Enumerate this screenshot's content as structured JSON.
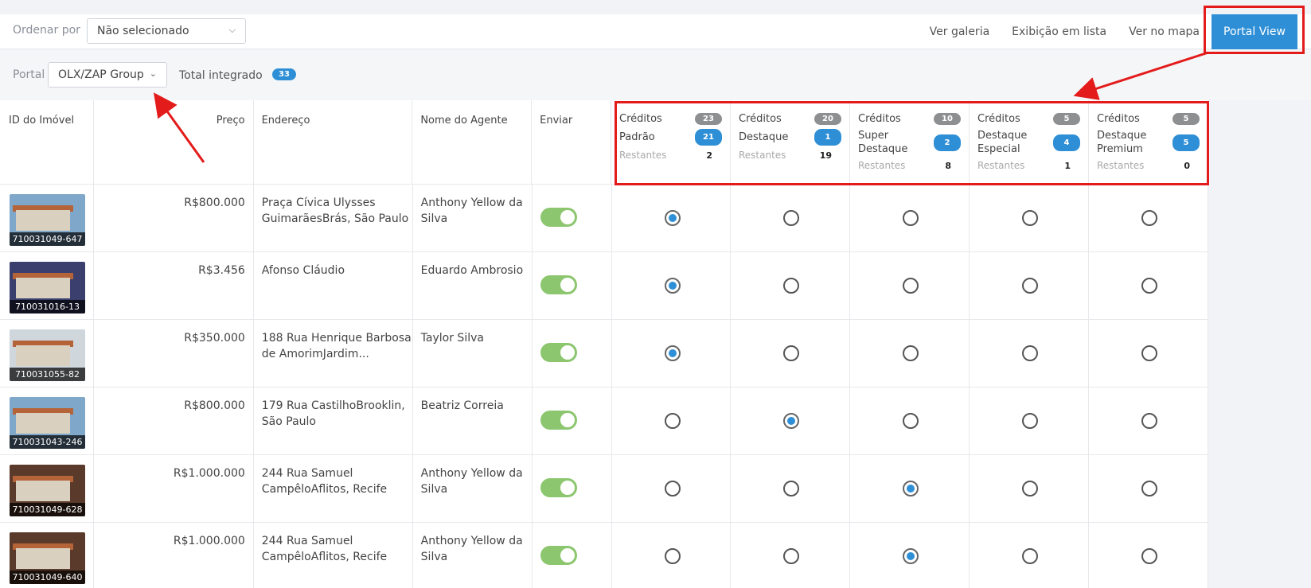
{
  "toolbar": {
    "sort_label": "Ordenar por",
    "sort_value": "Não selecionado",
    "views": [
      "Ver galeria",
      "Exibição em lista",
      "Ver no mapa"
    ],
    "portal_view_label": "Portal View"
  },
  "filters": {
    "portal_label": "Portal",
    "portal_value": "OLX/ZAP Group",
    "total_label": "Total integrado",
    "total_count": "33"
  },
  "columns": {
    "id": "ID do Imóvel",
    "price": "Preço",
    "address": "Endereço",
    "agent": "Nome do Agente",
    "send": "Enviar"
  },
  "credits": [
    {
      "credits_label": "Créditos",
      "credits": "23",
      "type_label": "Padrão",
      "type_count": "21",
      "remaining_label": "Restantes",
      "remaining": "2"
    },
    {
      "credits_label": "Créditos",
      "credits": "20",
      "type_label": "Destaque",
      "type_count": "1",
      "remaining_label": "Restantes",
      "remaining": "19"
    },
    {
      "credits_label": "Créditos",
      "credits": "10",
      "type_label": "Super Destaque",
      "type_count": "2",
      "remaining_label": "Restantes",
      "remaining": "8"
    },
    {
      "credits_label": "Créditos",
      "credits": "5",
      "type_label": "Destaque Especial",
      "type_count": "4",
      "remaining_label": "Restantes",
      "remaining": "1"
    },
    {
      "credits_label": "Créditos",
      "credits": "5",
      "type_label": "Destaque Premium",
      "type_count": "5",
      "remaining_label": "Restantes",
      "remaining": "0"
    }
  ],
  "rows": [
    {
      "id": "710031049-647",
      "price": "R$800.000",
      "address": "Praça Cívica Ulysses GuimarãesBrás, São Paulo",
      "agent": "Anthony Yellow da Silva",
      "send": true,
      "selected": 0
    },
    {
      "id": "710031016-13",
      "price": "R$3.456",
      "address": "Afonso Cláudio",
      "agent": "Eduardo Ambrosio",
      "send": true,
      "selected": 0
    },
    {
      "id": "710031055-82",
      "price": "R$350.000",
      "address": "188 Rua Henrique Barbosa de AmorimJardim...",
      "agent": "Taylor Silva",
      "send": true,
      "selected": 0
    },
    {
      "id": "710031043-246",
      "price": "R$800.000",
      "address": "179 Rua CastilhoBrooklin, São Paulo",
      "agent": "Beatriz Correia",
      "send": true,
      "selected": 1
    },
    {
      "id": "710031049-628",
      "price": "R$1.000.000",
      "address": "244 Rua Samuel CampêloAflitos, Recife",
      "agent": "Anthony Yellow da Silva",
      "send": true,
      "selected": 2
    },
    {
      "id": "710031049-640",
      "price": "R$1.000.000",
      "address": "244 Rua Samuel CampêloAflitos, Recife",
      "agent": "Anthony Yellow da Silva",
      "send": true,
      "selected": 2
    }
  ],
  "colors": {
    "accent": "#2e8fd6",
    "toggle": "#8cc66e",
    "annotation": "#e31b1b"
  }
}
